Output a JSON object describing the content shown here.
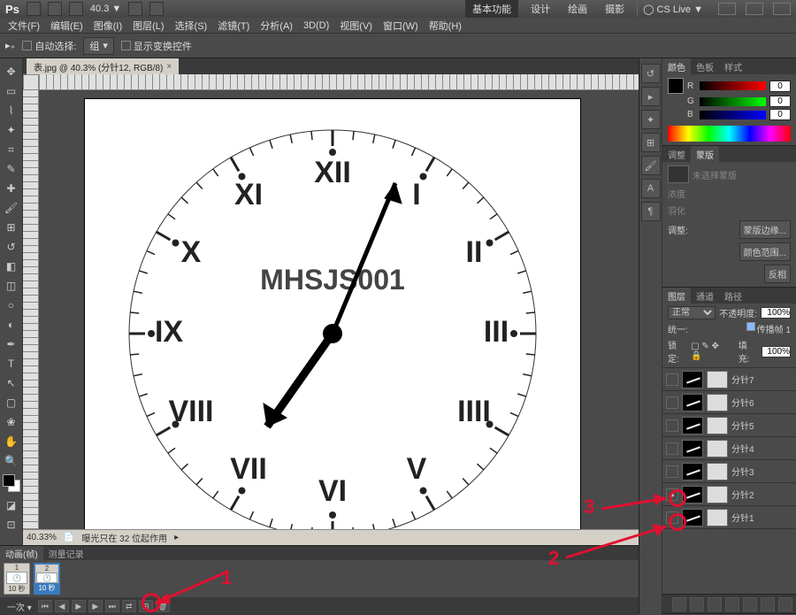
{
  "titlebar": {
    "app": "Ps",
    "zoom": "40.3",
    "workspace_active": "基本功能",
    "workspaces": [
      "设计",
      "绘画",
      "摄影"
    ],
    "cslive": "CS Live"
  },
  "menu": [
    "文件(F)",
    "编辑(E)",
    "图像(I)",
    "图层(L)",
    "选择(S)",
    "滤镜(T)",
    "分析(A)",
    "3D(D)",
    "视图(V)",
    "窗口(W)",
    "帮助(H)"
  ],
  "options": {
    "auto_select": "自动选择:",
    "group": "组",
    "show_transform": "显示变换控件"
  },
  "document": {
    "tab": "表.jpg @ 40.3% (分针12, RGB/8)",
    "zoom_status": "40.33%",
    "status_msg": "曝光只在 32 位起作用",
    "canvas_text": "MHSJS001"
  },
  "panels": {
    "color": {
      "tabs": [
        "颜色",
        "色板",
        "样式"
      ],
      "channels": [
        {
          "label": "R",
          "value": "0"
        },
        {
          "label": "G",
          "value": "0"
        },
        {
          "label": "B",
          "value": "0"
        }
      ]
    },
    "adjust": {
      "tabs": [
        "调整",
        "蒙版"
      ],
      "msg": "未选择蒙版",
      "density_lbl": "浓度",
      "feather_lbl": "羽化",
      "refine_lbl": "调整:",
      "btn_edge": "蒙版边缘...",
      "btn_range": "颜色范围...",
      "btn_invert": "反相"
    },
    "layers": {
      "tabs": [
        "图层",
        "通道",
        "路径"
      ],
      "blend": "正常",
      "opacity_lbl": "不透明度:",
      "opacity": "100%",
      "lock_lbl": "锁定:",
      "fill_lbl": "填充:",
      "fill": "100%",
      "unify": "统一:",
      "propagate": "传播帧 1",
      "items": [
        {
          "name": "分针7",
          "visible": false
        },
        {
          "name": "分针6",
          "visible": false
        },
        {
          "name": "分针5",
          "visible": false
        },
        {
          "name": "分针4",
          "visible": false
        },
        {
          "name": "分针3",
          "visible": false
        },
        {
          "name": "分针2",
          "visible": true,
          "selected": false
        },
        {
          "name": "分针1",
          "visible": false
        }
      ]
    }
  },
  "animation": {
    "tabs": [
      "动画(帧)",
      "测量记录"
    ],
    "frames": [
      {
        "n": "1",
        "dur": "10 秒"
      },
      {
        "n": "2",
        "dur": "10 秒",
        "selected": true
      }
    ],
    "loop": "一次"
  },
  "annotations": {
    "n1": "1",
    "n2": "2",
    "n3": "3"
  }
}
